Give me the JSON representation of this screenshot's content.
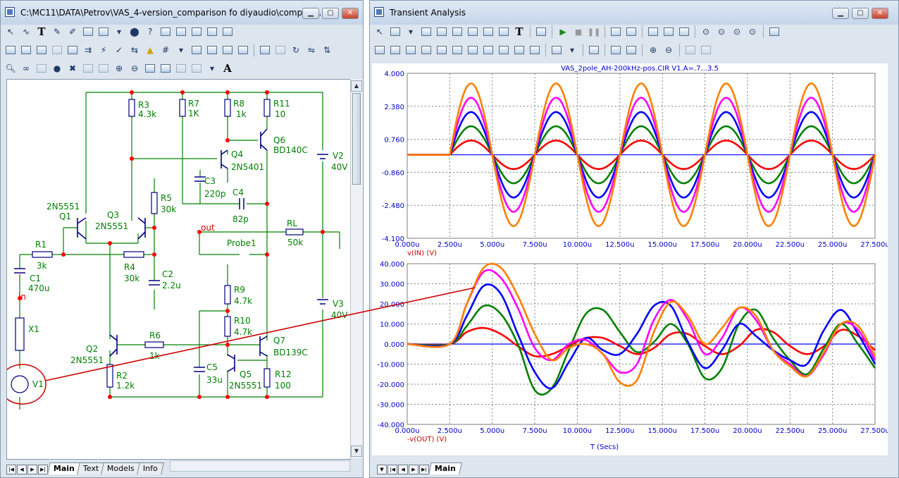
{
  "left_window": {
    "title": "C:\\MC11\\DATA\\Petrov\\VAS_4-version_comparison fo diyaudio\\compari...",
    "tabs": [
      "Main",
      "Text",
      "Models",
      "Info"
    ],
    "active_tab": "Main"
  },
  "right_window": {
    "title": "Transient Analysis",
    "tabs": [
      "Main"
    ],
    "active_tab": "Main"
  },
  "schematic": {
    "components": {
      "R1": {
        "name": "R1",
        "value": "3k"
      },
      "R2": {
        "name": "R2",
        "value": "1.2k"
      },
      "R3": {
        "name": "R3",
        "value": "4.3k"
      },
      "R4": {
        "name": "R4",
        "value": "30k"
      },
      "R5": {
        "name": "R5",
        "value": "30k"
      },
      "R6": {
        "name": "R6",
        "value": "1k"
      },
      "R7": {
        "name": "R7",
        "value": "1K"
      },
      "R8": {
        "name": "R8",
        "value": "1k"
      },
      "R9": {
        "name": "R9",
        "value": "4.7k"
      },
      "R10": {
        "name": "R10",
        "value": "4.7k"
      },
      "R11": {
        "name": "R11",
        "value": "10"
      },
      "R12": {
        "name": "R12",
        "value": "100"
      },
      "RL": {
        "name": "RL",
        "value": "50k"
      },
      "C1": {
        "name": "C1",
        "value": "470u"
      },
      "C2": {
        "name": "C2",
        "value": "2.2u"
      },
      "C3": {
        "name": "C3",
        "value": "220p"
      },
      "C4": {
        "name": "C4",
        "value": "82p"
      },
      "C5": {
        "name": "C5",
        "value": "33u"
      },
      "Q1": {
        "name": "Q1",
        "value": "2N5551"
      },
      "Q2": {
        "name": "Q2",
        "value": "2N5551"
      },
      "Q3": {
        "name": "Q3",
        "value": "2N5551"
      },
      "Q4": {
        "name": "Q4",
        "value": "2N5401"
      },
      "Q5": {
        "name": "Q5",
        "value": "2N5551"
      },
      "Q6": {
        "name": "Q6",
        "value": "BD140C"
      },
      "Q7": {
        "name": "Q7",
        "value": "BD139C"
      },
      "V1": {
        "name": "V1"
      },
      "V2": {
        "name": "V2",
        "value": "40V"
      },
      "V3": {
        "name": "V3",
        "value": "40V"
      },
      "X1": {
        "name": "X1"
      },
      "Probe1": {
        "name": "Probe1"
      }
    },
    "node_labels": {
      "in": "in",
      "out": "out"
    }
  },
  "plot_title": "VAS_2pole_AH-200kHz-pos.CIR V1.A=.7...3.5",
  "x_axis_label": "T (Secs)",
  "colors": {
    "series": [
      "#ff0000",
      "#008000",
      "#0000ff",
      "#ff00ff",
      "#ff8000"
    ],
    "axis_line": "#0000ff",
    "grid": "#7f7f7f",
    "label_blue": "#0000cc",
    "label_red": "#cc0000"
  },
  "chart_data": [
    {
      "type": "line",
      "ylabel": "v(IN) (V)",
      "x_ticks": [
        "0.000u",
        "2.500u",
        "5.000u",
        "7.500u",
        "10.000u",
        "12.500u",
        "15.000u",
        "17.500u",
        "20.000u",
        "22.500u",
        "25.000u",
        "27.500u"
      ],
      "y_ticks": [
        "4.000",
        "2.380",
        "0.760",
        "-0.860",
        "-2.480",
        "-4.100"
      ],
      "xlim": [
        0,
        27.5
      ],
      "ylim": [
        -4.1,
        4.0
      ],
      "x_unit": "u",
      "description_x": "time in microseconds",
      "series": [
        {
          "amplitude": 0.7,
          "start": 2.5,
          "period": 5.0,
          "values_at_peaks": [
            0.7,
            -0.7
          ]
        },
        {
          "amplitude": 1.4,
          "start": 2.5,
          "period": 5.0,
          "values_at_peaks": [
            1.4,
            -1.4
          ]
        },
        {
          "amplitude": 2.1,
          "start": 2.5,
          "period": 5.0,
          "values_at_peaks": [
            2.1,
            -2.1
          ]
        },
        {
          "amplitude": 2.8,
          "start": 2.5,
          "period": 5.0,
          "values_at_peaks": [
            2.8,
            -2.8
          ]
        },
        {
          "amplitude": 3.5,
          "start": 2.5,
          "period": 5.0,
          "values_at_peaks": [
            3.5,
            -3.5
          ]
        }
      ]
    },
    {
      "type": "line",
      "ylabel": "-v(OUT) (V)",
      "x_ticks": [
        "0.000u",
        "2.500u",
        "5.000u",
        "7.500u",
        "10.000u",
        "12.500u",
        "15.000u",
        "17.500u",
        "20.000u",
        "22.500u",
        "25.000u",
        "27.500u"
      ],
      "y_ticks": [
        "40.000",
        "30.000",
        "20.000",
        "10.000",
        "0.000",
        "-10.000",
        "-20.000",
        "-30.000",
        "-40.000"
      ],
      "xlim": [
        0,
        27.5
      ],
      "ylim": [
        -40,
        40
      ],
      "series": [
        {
          "points": [
            [
              0,
              0
            ],
            [
              2.5,
              0
            ],
            [
              3.5,
              6
            ],
            [
              4.5,
              8
            ],
            [
              5.5,
              5
            ],
            [
              6.5,
              -1
            ],
            [
              7.5,
              -6
            ],
            [
              8.5,
              -5
            ],
            [
              9.5,
              -1
            ],
            [
              10.5,
              3
            ],
            [
              11.5,
              3
            ],
            [
              12.5,
              -1
            ],
            [
              13.5,
              -5
            ],
            [
              14.5,
              -2
            ],
            [
              15.5,
              5
            ],
            [
              16.5,
              5
            ],
            [
              17.5,
              -1
            ],
            [
              18.5,
              -5
            ],
            [
              19.5,
              -1
            ],
            [
              20.5,
              7
            ],
            [
              21.5,
              6
            ],
            [
              22.5,
              -1
            ],
            [
              23.5,
              -5
            ],
            [
              24.5,
              -1
            ],
            [
              25.5,
              7
            ],
            [
              26.5,
              4
            ],
            [
              27.5,
              -3
            ]
          ]
        },
        {
          "points": [
            [
              0,
              0
            ],
            [
              2.5,
              0
            ],
            [
              3.5,
              9
            ],
            [
              4.5,
              19
            ],
            [
              5.5,
              15
            ],
            [
              6.5,
              0
            ],
            [
              7.5,
              -23
            ],
            [
              8.5,
              -22
            ],
            [
              9.5,
              -3
            ],
            [
              10.5,
              15
            ],
            [
              11.5,
              17
            ],
            [
              12.5,
              6
            ],
            [
              13.5,
              -4
            ],
            [
              14.5,
              1
            ],
            [
              15.5,
              10
            ],
            [
              16.5,
              0
            ],
            [
              17.5,
              -17
            ],
            [
              18.5,
              -12
            ],
            [
              19.5,
              10
            ],
            [
              20.5,
              17
            ],
            [
              21.5,
              3
            ],
            [
              22.5,
              -8
            ],
            [
              23.5,
              -15
            ],
            [
              24.5,
              -2
            ],
            [
              25.5,
              10
            ],
            [
              26.5,
              0
            ],
            [
              27.5,
              -12
            ]
          ]
        },
        {
          "points": [
            [
              0,
              0
            ],
            [
              2.5,
              0
            ],
            [
              3.5,
              14
            ],
            [
              4.5,
              29
            ],
            [
              5.5,
              25
            ],
            [
              6.5,
              5
            ],
            [
              7.5,
              -14
            ],
            [
              8.5,
              -22
            ],
            [
              9.5,
              -9
            ],
            [
              10.5,
              3
            ],
            [
              11.5,
              -3
            ],
            [
              12.5,
              -5
            ],
            [
              13.5,
              5
            ],
            [
              14.5,
              19
            ],
            [
              15.5,
              19
            ],
            [
              16.5,
              1
            ],
            [
              17.5,
              -12
            ],
            [
              18.5,
              -3
            ],
            [
              19.5,
              10
            ],
            [
              20.5,
              4
            ],
            [
              21.5,
              -3
            ],
            [
              22.5,
              -8
            ],
            [
              23.5,
              -10
            ],
            [
              24.5,
              7
            ],
            [
              25.5,
              17
            ],
            [
              26.5,
              5
            ],
            [
              27.5,
              -10
            ]
          ]
        },
        {
          "points": [
            [
              0,
              0
            ],
            [
              2.5,
              0
            ],
            [
              3.5,
              20
            ],
            [
              4.5,
              36
            ],
            [
              5.5,
              33
            ],
            [
              6.5,
              18
            ],
            [
              7.5,
              -2
            ],
            [
              8.5,
              -8
            ],
            [
              9.5,
              0
            ],
            [
              10.5,
              2
            ],
            [
              11.5,
              -5
            ],
            [
              12.5,
              -14
            ],
            [
              13.5,
              -10
            ],
            [
              14.5,
              12
            ],
            [
              15.5,
              22
            ],
            [
              16.5,
              12
            ],
            [
              17.5,
              -5
            ],
            [
              18.5,
              3
            ],
            [
              19.5,
              18
            ],
            [
              20.5,
              12
            ],
            [
              21.5,
              -3
            ],
            [
              22.5,
              -10
            ],
            [
              23.5,
              -16
            ],
            [
              24.5,
              -5
            ],
            [
              25.5,
              10
            ],
            [
              26.5,
              7
            ],
            [
              27.5,
              -8
            ]
          ]
        },
        {
          "points": [
            [
              0,
              0
            ],
            [
              2.5,
              0
            ],
            [
              3.5,
              20
            ],
            [
              4.5,
              38
            ],
            [
              5.5,
              38
            ],
            [
              6.5,
              24
            ],
            [
              7.5,
              5
            ],
            [
              8.5,
              -8
            ],
            [
              9.5,
              -2
            ],
            [
              10.5,
              0
            ],
            [
              11.5,
              -5
            ],
            [
              12.5,
              -19
            ],
            [
              13.5,
              -18
            ],
            [
              14.5,
              6
            ],
            [
              15.5,
              21
            ],
            [
              16.5,
              14
            ],
            [
              17.5,
              0
            ],
            [
              18.5,
              8
            ],
            [
              19.5,
              18
            ],
            [
              20.5,
              14
            ],
            [
              21.5,
              -3
            ],
            [
              22.5,
              -11
            ],
            [
              23.5,
              -16
            ],
            [
              24.5,
              -4
            ],
            [
              25.5,
              10
            ],
            [
              26.5,
              9
            ],
            [
              27.5,
              -6
            ]
          ]
        }
      ]
    }
  ]
}
